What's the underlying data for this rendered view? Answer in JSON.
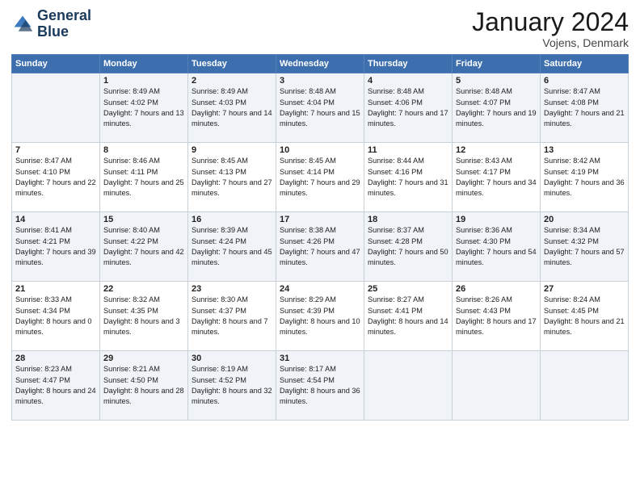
{
  "header": {
    "logo_line1": "General",
    "logo_line2": "Blue",
    "month_title": "January 2024",
    "location": "Vojens, Denmark"
  },
  "days_of_week": [
    "Sunday",
    "Monday",
    "Tuesday",
    "Wednesday",
    "Thursday",
    "Friday",
    "Saturday"
  ],
  "weeks": [
    [
      {
        "day": "",
        "sunrise": "",
        "sunset": "",
        "daylight": ""
      },
      {
        "day": "1",
        "sunrise": "Sunrise: 8:49 AM",
        "sunset": "Sunset: 4:02 PM",
        "daylight": "Daylight: 7 hours and 13 minutes."
      },
      {
        "day": "2",
        "sunrise": "Sunrise: 8:49 AM",
        "sunset": "Sunset: 4:03 PM",
        "daylight": "Daylight: 7 hours and 14 minutes."
      },
      {
        "day": "3",
        "sunrise": "Sunrise: 8:48 AM",
        "sunset": "Sunset: 4:04 PM",
        "daylight": "Daylight: 7 hours and 15 minutes."
      },
      {
        "day": "4",
        "sunrise": "Sunrise: 8:48 AM",
        "sunset": "Sunset: 4:06 PM",
        "daylight": "Daylight: 7 hours and 17 minutes."
      },
      {
        "day": "5",
        "sunrise": "Sunrise: 8:48 AM",
        "sunset": "Sunset: 4:07 PM",
        "daylight": "Daylight: 7 hours and 19 minutes."
      },
      {
        "day": "6",
        "sunrise": "Sunrise: 8:47 AM",
        "sunset": "Sunset: 4:08 PM",
        "daylight": "Daylight: 7 hours and 21 minutes."
      }
    ],
    [
      {
        "day": "7",
        "sunrise": "Sunrise: 8:47 AM",
        "sunset": "Sunset: 4:10 PM",
        "daylight": "Daylight: 7 hours and 22 minutes."
      },
      {
        "day": "8",
        "sunrise": "Sunrise: 8:46 AM",
        "sunset": "Sunset: 4:11 PM",
        "daylight": "Daylight: 7 hours and 25 minutes."
      },
      {
        "day": "9",
        "sunrise": "Sunrise: 8:45 AM",
        "sunset": "Sunset: 4:13 PM",
        "daylight": "Daylight: 7 hours and 27 minutes."
      },
      {
        "day": "10",
        "sunrise": "Sunrise: 8:45 AM",
        "sunset": "Sunset: 4:14 PM",
        "daylight": "Daylight: 7 hours and 29 minutes."
      },
      {
        "day": "11",
        "sunrise": "Sunrise: 8:44 AM",
        "sunset": "Sunset: 4:16 PM",
        "daylight": "Daylight: 7 hours and 31 minutes."
      },
      {
        "day": "12",
        "sunrise": "Sunrise: 8:43 AM",
        "sunset": "Sunset: 4:17 PM",
        "daylight": "Daylight: 7 hours and 34 minutes."
      },
      {
        "day": "13",
        "sunrise": "Sunrise: 8:42 AM",
        "sunset": "Sunset: 4:19 PM",
        "daylight": "Daylight: 7 hours and 36 minutes."
      }
    ],
    [
      {
        "day": "14",
        "sunrise": "Sunrise: 8:41 AM",
        "sunset": "Sunset: 4:21 PM",
        "daylight": "Daylight: 7 hours and 39 minutes."
      },
      {
        "day": "15",
        "sunrise": "Sunrise: 8:40 AM",
        "sunset": "Sunset: 4:22 PM",
        "daylight": "Daylight: 7 hours and 42 minutes."
      },
      {
        "day": "16",
        "sunrise": "Sunrise: 8:39 AM",
        "sunset": "Sunset: 4:24 PM",
        "daylight": "Daylight: 7 hours and 45 minutes."
      },
      {
        "day": "17",
        "sunrise": "Sunrise: 8:38 AM",
        "sunset": "Sunset: 4:26 PM",
        "daylight": "Daylight: 7 hours and 47 minutes."
      },
      {
        "day": "18",
        "sunrise": "Sunrise: 8:37 AM",
        "sunset": "Sunset: 4:28 PM",
        "daylight": "Daylight: 7 hours and 50 minutes."
      },
      {
        "day": "19",
        "sunrise": "Sunrise: 8:36 AM",
        "sunset": "Sunset: 4:30 PM",
        "daylight": "Daylight: 7 hours and 54 minutes."
      },
      {
        "day": "20",
        "sunrise": "Sunrise: 8:34 AM",
        "sunset": "Sunset: 4:32 PM",
        "daylight": "Daylight: 7 hours and 57 minutes."
      }
    ],
    [
      {
        "day": "21",
        "sunrise": "Sunrise: 8:33 AM",
        "sunset": "Sunset: 4:34 PM",
        "daylight": "Daylight: 8 hours and 0 minutes."
      },
      {
        "day": "22",
        "sunrise": "Sunrise: 8:32 AM",
        "sunset": "Sunset: 4:35 PM",
        "daylight": "Daylight: 8 hours and 3 minutes."
      },
      {
        "day": "23",
        "sunrise": "Sunrise: 8:30 AM",
        "sunset": "Sunset: 4:37 PM",
        "daylight": "Daylight: 8 hours and 7 minutes."
      },
      {
        "day": "24",
        "sunrise": "Sunrise: 8:29 AM",
        "sunset": "Sunset: 4:39 PM",
        "daylight": "Daylight: 8 hours and 10 minutes."
      },
      {
        "day": "25",
        "sunrise": "Sunrise: 8:27 AM",
        "sunset": "Sunset: 4:41 PM",
        "daylight": "Daylight: 8 hours and 14 minutes."
      },
      {
        "day": "26",
        "sunrise": "Sunrise: 8:26 AM",
        "sunset": "Sunset: 4:43 PM",
        "daylight": "Daylight: 8 hours and 17 minutes."
      },
      {
        "day": "27",
        "sunrise": "Sunrise: 8:24 AM",
        "sunset": "Sunset: 4:45 PM",
        "daylight": "Daylight: 8 hours and 21 minutes."
      }
    ],
    [
      {
        "day": "28",
        "sunrise": "Sunrise: 8:23 AM",
        "sunset": "Sunset: 4:47 PM",
        "daylight": "Daylight: 8 hours and 24 minutes."
      },
      {
        "day": "29",
        "sunrise": "Sunrise: 8:21 AM",
        "sunset": "Sunset: 4:50 PM",
        "daylight": "Daylight: 8 hours and 28 minutes."
      },
      {
        "day": "30",
        "sunrise": "Sunrise: 8:19 AM",
        "sunset": "Sunset: 4:52 PM",
        "daylight": "Daylight: 8 hours and 32 minutes."
      },
      {
        "day": "31",
        "sunrise": "Sunrise: 8:17 AM",
        "sunset": "Sunset: 4:54 PM",
        "daylight": "Daylight: 8 hours and 36 minutes."
      },
      {
        "day": "",
        "sunrise": "",
        "sunset": "",
        "daylight": ""
      },
      {
        "day": "",
        "sunrise": "",
        "sunset": "",
        "daylight": ""
      },
      {
        "day": "",
        "sunrise": "",
        "sunset": "",
        "daylight": ""
      }
    ]
  ]
}
